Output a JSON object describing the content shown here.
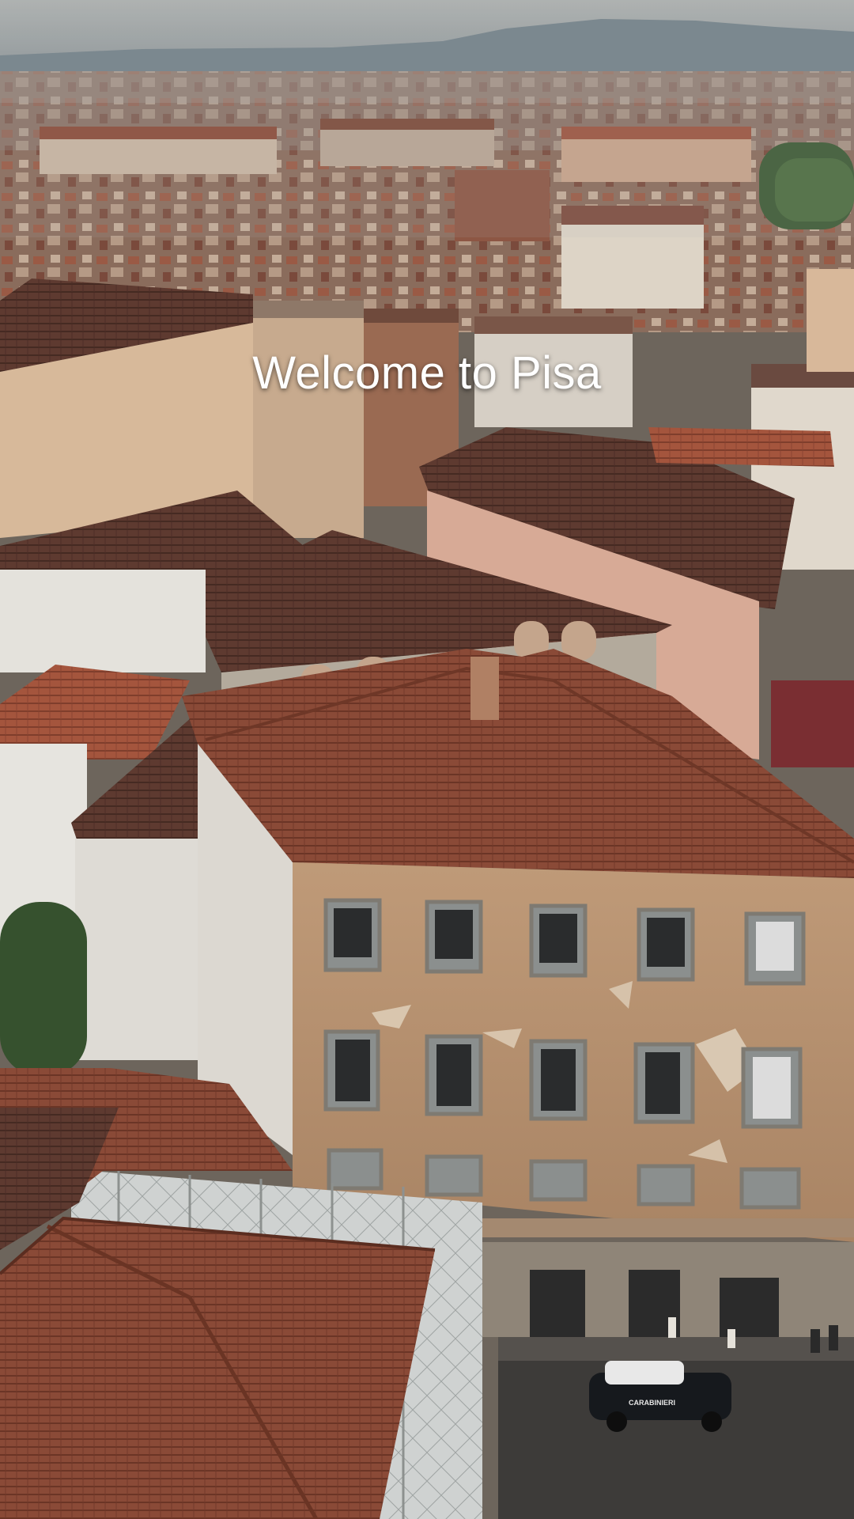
{
  "overlay": {
    "caption": "Welcome to Pisa"
  },
  "scene": {
    "car_text": "CARABINIERI"
  },
  "colors": {
    "sky": "#9da4a6",
    "hills": "#6f7c84",
    "terracotta": "#8e4a38",
    "old_facade": "#b48d6c",
    "white_wall": "#dcd9d2",
    "street": "#3c3a38"
  }
}
